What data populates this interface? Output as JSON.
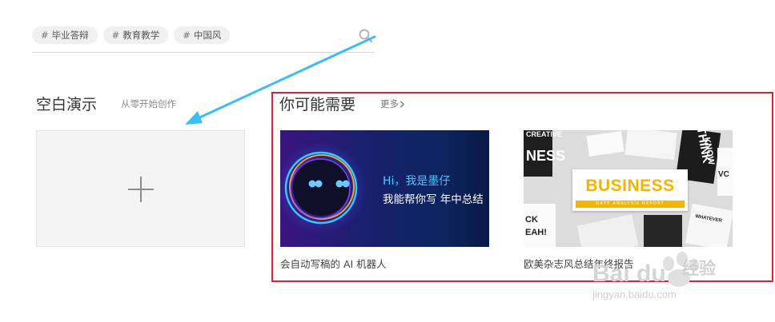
{
  "search": {
    "tags": [
      {
        "hash": "#",
        "label": "毕业答辩"
      },
      {
        "hash": "#",
        "label": "教育教学"
      },
      {
        "hash": "#",
        "label": "中国风"
      }
    ]
  },
  "blank": {
    "title": "空白演示",
    "subtitle": "从零开始创作"
  },
  "recommend": {
    "title": "你可能需要",
    "more": "更多",
    "more_icon": "chevron-right-icon",
    "cards": [
      {
        "caption": "会自动写稿的 AI 机器人",
        "line1": "Hi，我是墨仔",
        "line2": "我能帮你写 年中总结"
      },
      {
        "caption": "欧美杂志风总结年终报告",
        "headline": "BUSINESS",
        "subline": "DATE ANALYSIS REPORT",
        "decor": [
          "CREATIVE",
          "NESS",
          "THINK",
          "KNOW",
          "CK",
          "EAH!",
          "WHATEVER",
          "VC"
        ]
      }
    ]
  },
  "annotations": {
    "arrow_color": "#3dbef0",
    "highlight_color": "#d9252f"
  },
  "watermark": {
    "brand": "Bai du",
    "text": "经验",
    "url": "jingyan.baidu.com"
  }
}
